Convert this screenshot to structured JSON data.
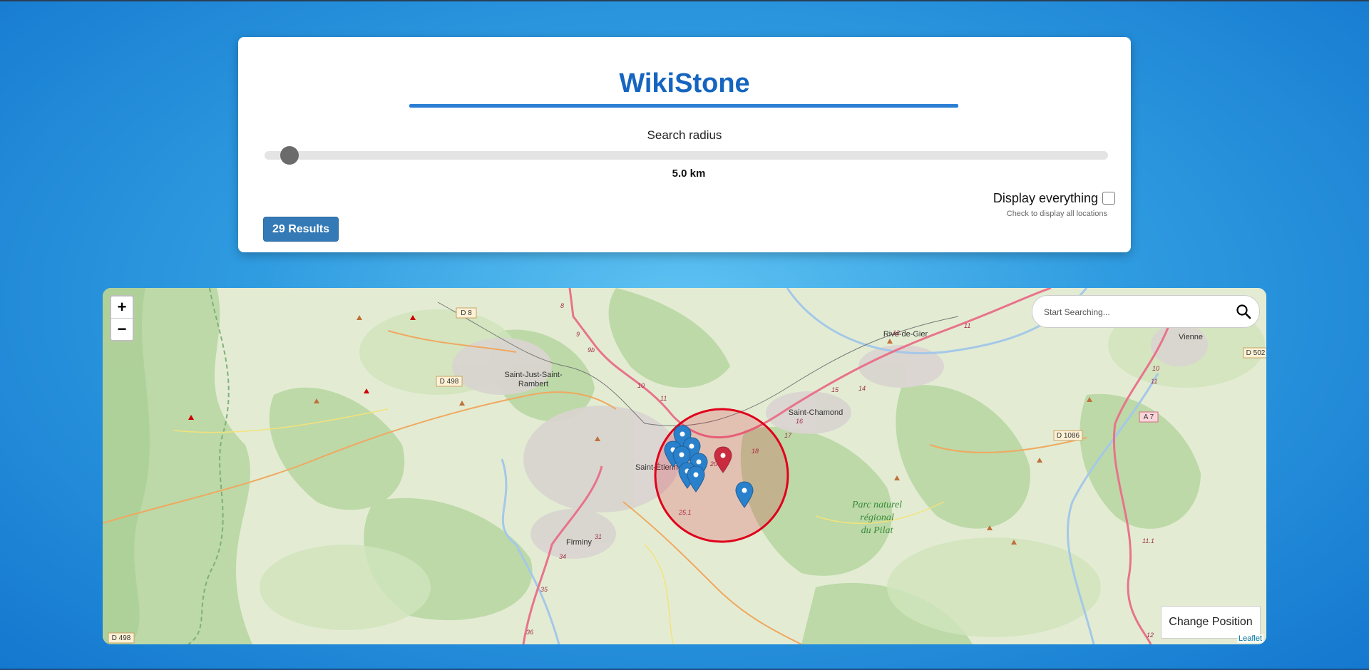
{
  "app": {
    "title": "WikiStone"
  },
  "controls": {
    "radius_label": "Search radius",
    "radius_value": "5.0 km",
    "radius_fraction": 0.03,
    "display_all_label": "Display everything",
    "display_all_checked": false,
    "display_all_hint": "Check to display all locations",
    "results_label": "29 Results"
  },
  "map": {
    "zoom_in": "+",
    "zoom_out": "−",
    "search_placeholder": "Start Searching...",
    "search_icon": "magnifier-icon",
    "change_position_label": "Change Position",
    "attribution": "Leaflet",
    "towns": [
      "Saint-Just-Saint-Rambert",
      "Saint-Chamond",
      "Rive-de-Gier",
      "Vienne",
      "Firminy",
      "Saint-Étienne"
    ],
    "park_label": [
      "Parc naturel",
      "régional",
      "du Pilat"
    ],
    "road_labels": [
      "D 8",
      "D 498",
      "D 498",
      "A 7",
      "D 1086",
      "D 502"
    ],
    "route_numbers": [
      "8",
      "9",
      "9b",
      "10",
      "11",
      "12",
      "14",
      "15",
      "16",
      "17",
      "18",
      "20",
      "25.1",
      "31",
      "34",
      "35",
      "36",
      "10",
      "11",
      "11.1",
      "12"
    ],
    "colors": {
      "circle": "#e0001b",
      "marker_blue": "#2a81cb",
      "marker_red": "#cb2b3e"
    }
  }
}
